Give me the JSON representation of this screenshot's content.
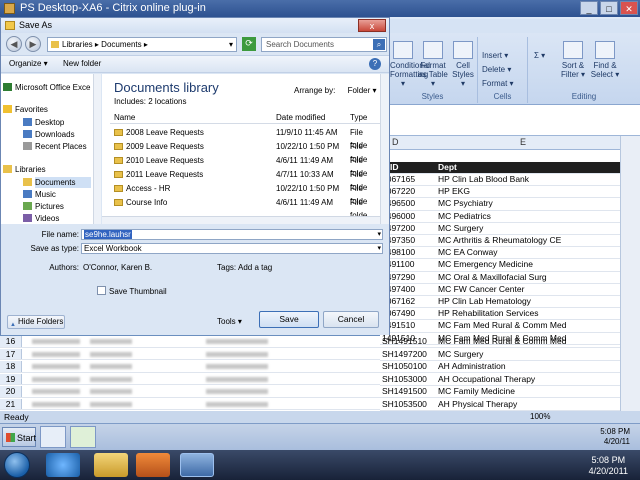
{
  "window": {
    "title": "PS Desktop-XA6 - Citrix online plug-in"
  },
  "dialog": {
    "title": "Save As",
    "address": {
      "parts": [
        "Libraries",
        "Documents"
      ]
    },
    "search_placeholder": "Search Documents",
    "toolbar": {
      "organize": "Organize ▾",
      "new_folder": "New folder",
      "help": "?"
    },
    "nav": {
      "top_item": "Microsoft Office Exce",
      "favorites": "Favorites",
      "fav_items": [
        "Desktop",
        "Downloads",
        "Recent Places"
      ],
      "libraries": "Libraries",
      "lib_items": [
        "Documents",
        "Music",
        "Pictures",
        "Videos"
      ]
    },
    "library": {
      "title": "Documents library",
      "includes": "Includes:  2 locations",
      "arrange_label": "Arrange by:",
      "arrange_value": "Folder  ▾"
    },
    "columns": {
      "name": "Name",
      "date": "Date modified",
      "type": "Type"
    },
    "files": [
      {
        "name": "2008 Leave Requests",
        "date": "11/9/10 11:45 AM",
        "type": "File folde"
      },
      {
        "name": "2009 Leave Requests",
        "date": "10/22/10 1:50 PM",
        "type": "File folde"
      },
      {
        "name": "2010 Leave Requests",
        "date": "4/6/11 11:49 AM",
        "type": "File folde"
      },
      {
        "name": "2011 Leave Requests",
        "date": "4/7/11 10:33 AM",
        "type": "File folde"
      },
      {
        "name": "Access - HR",
        "date": "10/22/10 1:50 PM",
        "type": "File folde"
      },
      {
        "name": "Course Info",
        "date": "4/6/11 11:49 AM",
        "type": "File folde"
      }
    ],
    "form": {
      "file_name_label": "File name:",
      "file_name_value": "se9he.lauhsr",
      "save_type_label": "Save as type:",
      "save_type_value": "Excel Workbook",
      "authors_label": "Authors:",
      "authors_value": "O'Connor, Karen B.",
      "tags_label": "Tags:",
      "tags_value": "Add a tag",
      "thumbnail_label": "Save Thumbnail"
    },
    "buttons": {
      "hide_folders": "Hide Folders",
      "tools": "Tools  ▾",
      "save": "Save",
      "cancel": "Cancel",
      "close": "x"
    }
  },
  "ribbon": {
    "format_items": [
      "Conditional",
      "Formatting ▾"
    ],
    "format_table": [
      "Format",
      "as Table ▾"
    ],
    "cell_styles": [
      "Cell",
      "Styles ▾"
    ],
    "styles_group": "Styles",
    "insert": "Insert ▾",
    "delete": "Delete ▾",
    "format": "Format ▾",
    "cells_group": "Cells",
    "sort": [
      "Sort &",
      "Filter ▾"
    ],
    "find": [
      "Find &",
      "Select ▾"
    ],
    "editing_group": "Editing"
  },
  "sheet": {
    "col_d": "D",
    "col_e": "E",
    "headers": [
      "ptID",
      "Dept"
    ],
    "rows": [
      [
        "2067165",
        "HP Clin Lab Blood Bank"
      ],
      [
        "2067220",
        "HP EKG"
      ],
      [
        "1496500",
        "MC Psychiatry"
      ],
      [
        "1496000",
        "MC Pediatrics"
      ],
      [
        "1497200",
        "MC Surgery"
      ],
      [
        "1497350",
        "MC Arthritis & Rheumatology CE"
      ],
      [
        "1498100",
        "MC EA Conway"
      ],
      [
        "1491100",
        "MC Emergency Medicine"
      ],
      [
        "1497290",
        "MC Oral & Maxillofacial Surg"
      ],
      [
        "1497400",
        "MC FW Cancer Center"
      ],
      [
        "2067162",
        "HP Clin Lab Hematology"
      ],
      [
        "2067490",
        "HP Rehabilitation Services"
      ],
      [
        "1491510",
        "MC Fam Med Rural & Comm Med"
      ],
      [
        "1491510",
        "MC Fam Med Rural & Comm Med"
      ]
    ],
    "lower_rows": [
      [
        "16",
        "SH1491510",
        "MC Fam Med Rural & Comm Med"
      ],
      [
        "17",
        "SH1497200",
        "MC Surgery"
      ],
      [
        "18",
        "SH1050100",
        "AH Administration"
      ],
      [
        "19",
        "SH1053000",
        "AH Occupational Therapy"
      ],
      [
        "20",
        "SH1491500",
        "MC Family Medicine"
      ],
      [
        "21",
        "SH1053500",
        "AH Physical Therapy"
      ]
    ],
    "zoom": "100%",
    "status": "Ready"
  },
  "inner_taskbar": {
    "start": "Start",
    "time": "5:08 PM",
    "date": "4/20/11"
  },
  "taskbar": {
    "time": "5:08 PM",
    "date": "4/20/2011"
  }
}
